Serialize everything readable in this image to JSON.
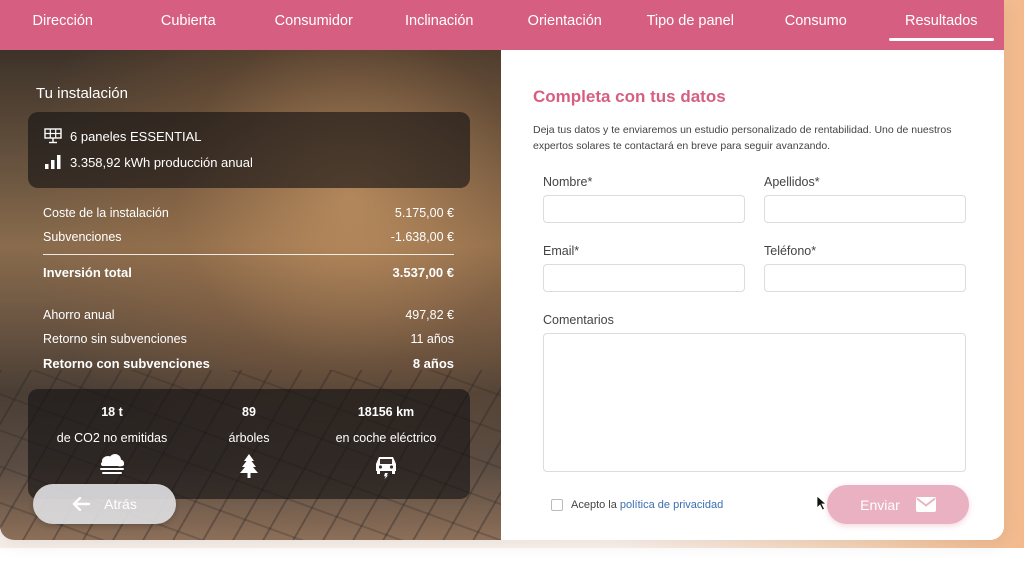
{
  "nav": {
    "items": [
      "Dirección",
      "Cubierta",
      "Consumidor",
      "Inclinación",
      "Orientación",
      "Tipo de panel",
      "Consumo",
      "Resultados"
    ],
    "active_index": 7
  },
  "installation": {
    "title": "Tu instalación",
    "panels": "6 paneles ESSENTIAL",
    "production": "3.358,92 kWh producción anual",
    "panels_icon": "solar-panel-icon",
    "production_icon": "bar-chart-icon"
  },
  "costs": {
    "install_label": "Coste de la instalación",
    "install_value": "5.175,00 €",
    "subsidy_label": "Subvenciones",
    "subsidy_value": "-1.638,00 €",
    "total_label": "Inversión total",
    "total_value": "3.537,00 €",
    "savings_label": "Ahorro anual",
    "savings_value": "497,82 €",
    "return_no_label": "Retorno sin subvenciones",
    "return_no_value": "11 años",
    "return_with_label": "Retorno con subvenciones",
    "return_with_value": "8 años"
  },
  "eco": {
    "co2_value": "18 t",
    "co2_label": "de CO2 no emitidas",
    "trees_value": "89",
    "trees_label": "árboles",
    "car_value": "18156 km",
    "car_label": "en coche eléctrico"
  },
  "back_label": "Atrás",
  "form": {
    "title": "Completa con tus datos",
    "description": "Deja tus datos y te enviaremos un estudio personalizado de rentabilidad. Uno de nuestros expertos solares te contactará en breve para seguir avanzando.",
    "name_label": "Nombre*",
    "name_value": "",
    "surname_label": "Apellidos*",
    "surname_value": "",
    "email_label": "Email*",
    "email_value": "",
    "phone_label": "Teléfono*",
    "phone_value": "",
    "comments_label": "Comentarios",
    "comments_value": "",
    "privacy_prefix": "Acepto la",
    "privacy_link": "política de privacidad",
    "privacy_checked": false,
    "send_label": "Enviar"
  },
  "colors": {
    "brand": "#d65f81",
    "send_button": "#eab1c2",
    "link": "#3b6fb3"
  }
}
